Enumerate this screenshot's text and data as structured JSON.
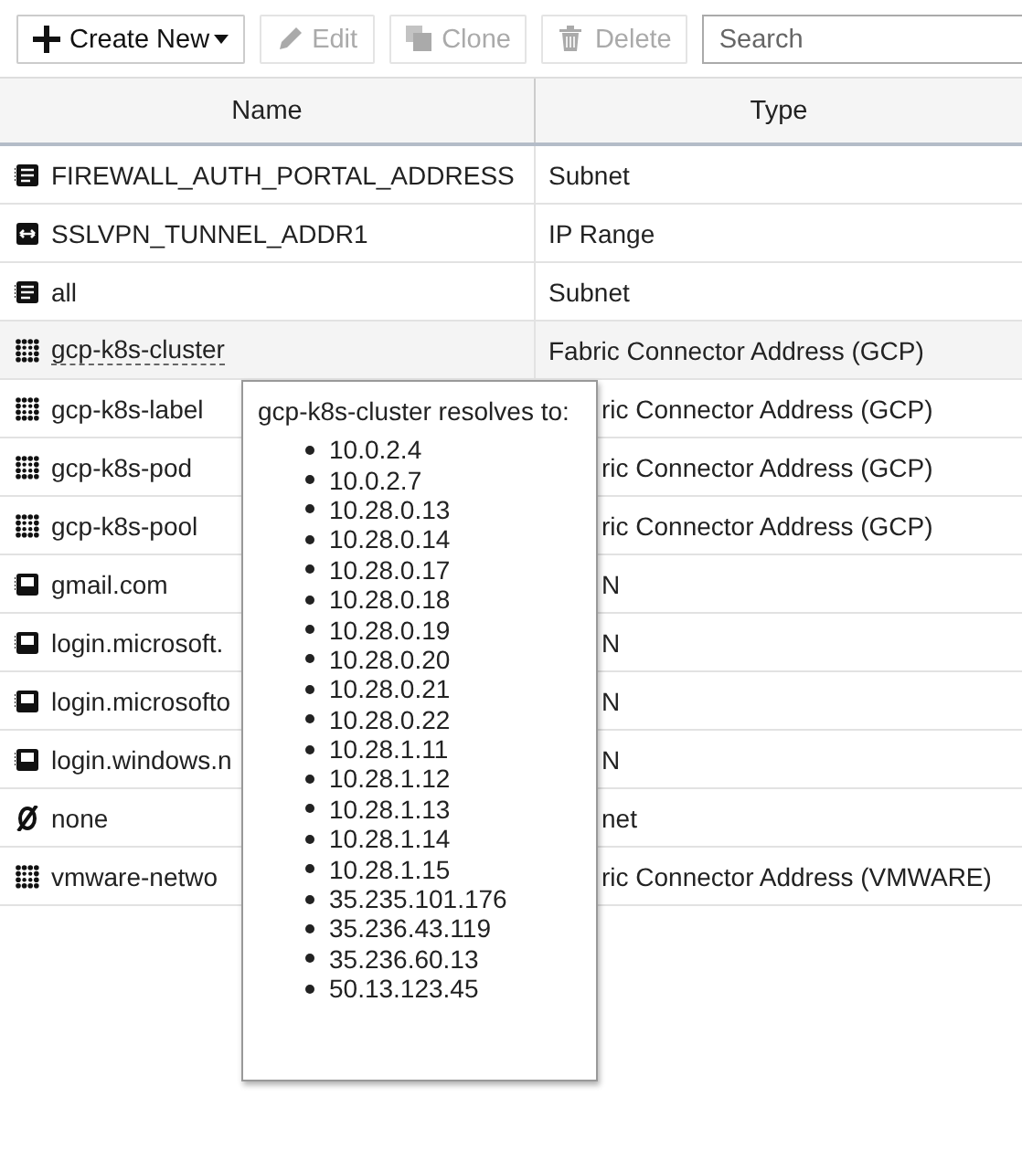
{
  "toolbar": {
    "buttons": [
      {
        "label": "Create New",
        "kind": "plus",
        "disabled": false,
        "dropdown": true
      },
      {
        "label": "Edit",
        "kind": "pencil",
        "disabled": true,
        "dropdown": false
      },
      {
        "label": "Clone",
        "kind": "clone",
        "disabled": true,
        "dropdown": false
      },
      {
        "label": "Delete",
        "kind": "trash",
        "disabled": true,
        "dropdown": false
      }
    ],
    "search": {
      "placeholder": "Search"
    }
  },
  "table": {
    "columns": [
      "Name",
      "Type"
    ],
    "rows": [
      {
        "kind": "subnet",
        "name": "FIREWALL_AUTH_PORTAL_ADDRESS",
        "type": "Subnet",
        "hovered": false
      },
      {
        "kind": "range",
        "name": "SSLVPN_TUNNEL_ADDR1",
        "type": "IP Range",
        "hovered": false
      },
      {
        "kind": "subnet",
        "name": "all",
        "type": "Subnet",
        "hovered": false
      },
      {
        "kind": "fabric",
        "name": "gcp-k8s-cluster",
        "type": "Fabric Connector Address (GCP)",
        "hovered": true
      },
      {
        "kind": "fabric",
        "name": "gcp-k8s-label",
        "type": "ric Connector Address (GCP)",
        "hovered": false
      },
      {
        "kind": "fabric",
        "name": "gcp-k8s-pod",
        "type": "ric Connector Address (GCP)",
        "hovered": false
      },
      {
        "kind": "fabric",
        "name": "gcp-k8s-pool",
        "type": "ric Connector Address (GCP)",
        "hovered": false
      },
      {
        "kind": "fqdn",
        "name": "gmail.com",
        "type": "N",
        "hovered": false
      },
      {
        "kind": "fqdn",
        "name": "login.microsoft.",
        "type": "N",
        "hovered": false
      },
      {
        "kind": "fqdn",
        "name": "login.microsofto",
        "type": "N",
        "hovered": false
      },
      {
        "kind": "fqdn",
        "name": "login.windows.n",
        "type": "N",
        "hovered": false
      },
      {
        "kind": "none",
        "name": "none",
        "type": "net",
        "hovered": false
      },
      {
        "kind": "fabric",
        "name": "vmware-netwo",
        "type": "ric Connector Address (VMWARE)",
        "hovered": false
      }
    ]
  },
  "tooltip": {
    "title": "gcp-k8s-cluster resolves to:",
    "items": [
      "10.0.2.4",
      "10.0.2.7",
      "10.28.0.13",
      "10.28.0.14",
      "10.28.0.17",
      "10.28.0.18",
      "10.28.0.19",
      "10.28.0.20",
      "10.28.0.21",
      "10.28.0.22",
      "10.28.1.11",
      "10.28.1.12",
      "10.28.1.13",
      "10.28.1.14",
      "10.28.1.15",
      "35.235.101.176",
      "35.236.43.119",
      "35.236.60.13",
      "50.13.123.45"
    ]
  }
}
